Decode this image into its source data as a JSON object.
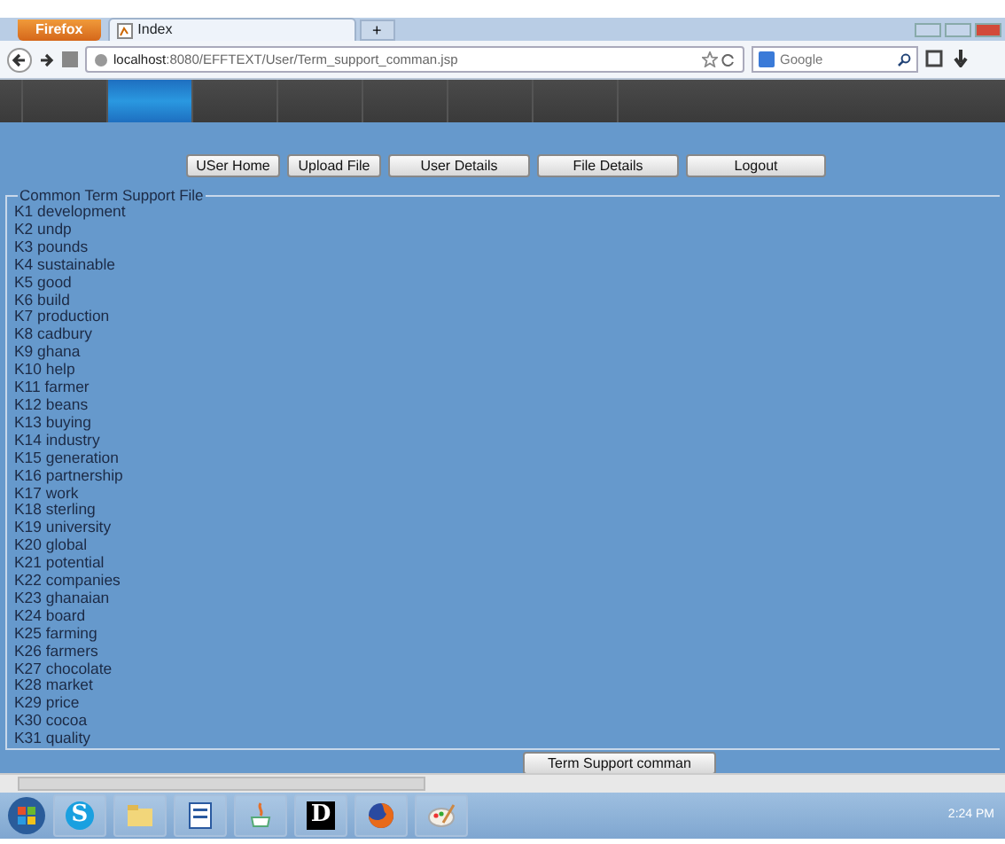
{
  "browser": {
    "menu_button": "Firefox",
    "tabs": [
      {
        "title": "Index",
        "selected": true
      }
    ],
    "new_tab": "+",
    "url_host": "localhost",
    "url_rest": ":8080/EFFTEXT/User/Term_support_comman.jsp",
    "search_placeholder": "Google"
  },
  "site_menu": [
    {
      "selected": false
    },
    {
      "selected": true
    },
    {
      "selected": false
    },
    {
      "selected": false
    },
    {
      "selected": false
    },
    {
      "selected": false
    },
    {
      "selected": false
    },
    {
      "selected": false
    }
  ],
  "nav_buttons": [
    "USer Home",
    "Upload File",
    "User Details",
    "File Details",
    "Logout"
  ],
  "fieldset": {
    "legend": "Common Term Support File",
    "items": [
      "K1 development",
      "K2 undp",
      "K3 pounds",
      "K4 sustainable",
      "K5 good",
      "K6 build",
      "K7 production",
      "K8 cadbury",
      "K9 ghana",
      "K10 help",
      "K11 farmer",
      "K12 beans",
      "K13 buying",
      "K14 industry",
      "K15 generation",
      "K16 partnership",
      "K17 work",
      "K18 sterling",
      "K19 university",
      "K20 global",
      "K21 potential",
      "K22 companies",
      "K23 ghanaian",
      "K24 board",
      "K25 farming",
      "K26 farmers",
      "K27 chocolate",
      "K28 market",
      "K29 price",
      "K30 cocoa",
      "K31 quality"
    ]
  },
  "action_button": "Term Support comman",
  "taskbar": {
    "apps": [
      {
        "kind": "skype",
        "glyph": "S"
      },
      {
        "kind": "folder"
      },
      {
        "kind": "word"
      },
      {
        "kind": "java"
      },
      {
        "kind": "dlink",
        "glyph": "D"
      },
      {
        "kind": "firefox"
      },
      {
        "kind": "paint"
      }
    ],
    "clock": "2:24 PM"
  }
}
